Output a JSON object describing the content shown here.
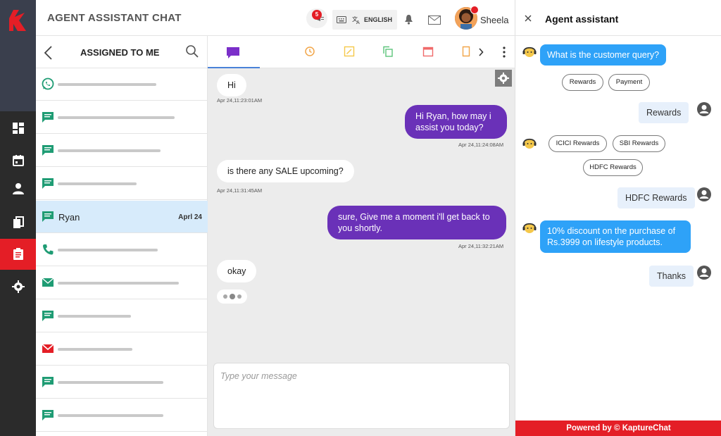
{
  "app": {
    "title": "AGENT ASSISTANT CHAT",
    "brand_color": "#e41e26",
    "accent_purple": "#6a31b8",
    "accent_blue": "#2ea2f8"
  },
  "header": {
    "notification_count": "5",
    "language": "ENGLISH",
    "user_name": "Sheela"
  },
  "rail": {
    "items": [
      "dashboard-icon",
      "calendar-icon",
      "user-icon",
      "documents-icon",
      "notes-icon",
      "settings-icon"
    ],
    "active": "notes-icon"
  },
  "list": {
    "title": "ASSIGNED TO ME",
    "items": [
      {
        "channel": "whatsapp"
      },
      {
        "channel": "chat"
      },
      {
        "channel": "chat"
      },
      {
        "channel": "chat"
      },
      {
        "channel": "chat",
        "name": "Ryan",
        "date": "Aprl 24",
        "active": true
      },
      {
        "channel": "phone"
      },
      {
        "channel": "email"
      },
      {
        "channel": "chat"
      },
      {
        "channel": "gmail"
      },
      {
        "channel": "chat"
      },
      {
        "channel": "chat"
      }
    ]
  },
  "chat": {
    "messages": [
      {
        "dir": "in",
        "text": "Hi",
        "time": "Apr 24,11:23:01AM"
      },
      {
        "dir": "out",
        "text": "Hi Ryan, how may i assist you today?",
        "time": "Apr 24,11:24:08AM"
      },
      {
        "dir": "in",
        "text": "is there any SALE upcoming?",
        "time": "Apr 24,11:31:45AM"
      },
      {
        "dir": "out",
        "text": "sure, Give me a moment i'll get back to you shortly.",
        "time": "Apr 24,11:32:21AM"
      },
      {
        "dir": "in",
        "text": "okay"
      }
    ],
    "composer_placeholder": "Type your message"
  },
  "assistant": {
    "title": "Agent assistant",
    "question": "What is the customer query?",
    "options1": [
      "Rewards",
      "Payment"
    ],
    "answer1": "Rewards",
    "options2": [
      "ICICI Rewards",
      "SBI Rewards",
      "HDFC Rewards"
    ],
    "answer2": "HDFC Rewards",
    "info": "10% discount on the purchase of Rs.3999 on lifestyle products.",
    "answer3": "Thanks",
    "powered_by": "Powered by © KaptureChat"
  }
}
